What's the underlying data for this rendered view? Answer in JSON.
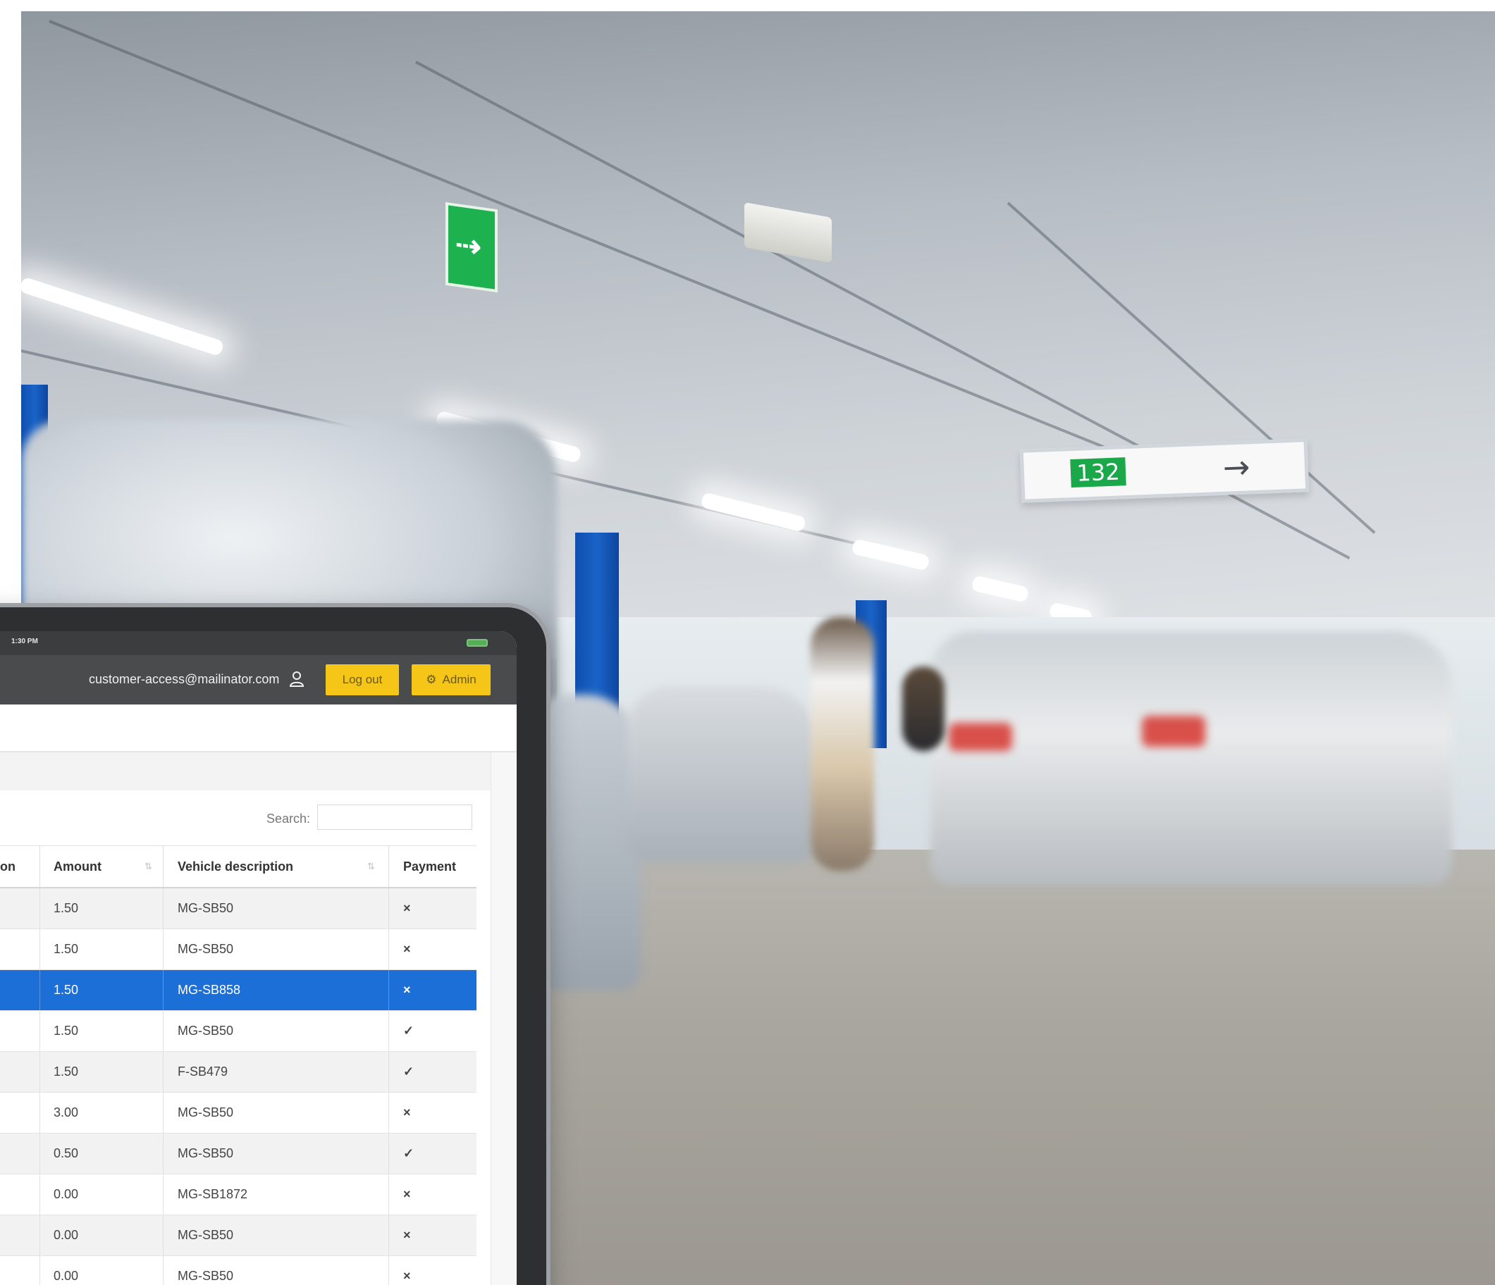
{
  "photo": {
    "guide_sign_number": "132",
    "guide_sign_arrow": "→",
    "exit_sign_glyph": "⇢"
  },
  "statusbar": {
    "time": "1:30 PM"
  },
  "topbar": {
    "user_email": "customer-access@mailinator.com",
    "logout_label": "Log out",
    "admin_label": "Admin",
    "user_icon": "user-icon",
    "admin_icon": "gear-icon"
  },
  "table": {
    "search_label": "Search:",
    "search_value": "",
    "columns": [
      {
        "label": "on"
      },
      {
        "label": "Amount"
      },
      {
        "label": "Vehicle description"
      },
      {
        "label": "Payment"
      }
    ],
    "rows": [
      {
        "amount": "1.50",
        "vehicle": "MG-SB50",
        "payment": "×",
        "paid": false
      },
      {
        "amount": "1.50",
        "vehicle": "MG-SB50",
        "payment": "×",
        "paid": false
      },
      {
        "amount": "1.50",
        "vehicle": "MG-SB858",
        "payment": "×",
        "paid": false,
        "selected": true
      },
      {
        "amount": "1.50",
        "vehicle": "MG-SB50",
        "payment": "✓",
        "paid": true
      },
      {
        "amount": "1.50",
        "vehicle": "F-SB479",
        "payment": "✓",
        "paid": true
      },
      {
        "amount": "3.00",
        "vehicle": "MG-SB50",
        "payment": "×",
        "paid": false
      },
      {
        "amount": "0.50",
        "vehicle": "MG-SB50",
        "payment": "✓",
        "paid": true
      },
      {
        "amount": "0.00",
        "vehicle": "MG-SB1872",
        "payment": "×",
        "paid": false
      },
      {
        "amount": "0.00",
        "vehicle": "MG-SB50",
        "payment": "×",
        "paid": false
      },
      {
        "amount": "0.00",
        "vehicle": "MG-SB50",
        "payment": "×",
        "paid": false
      }
    ]
  },
  "colors": {
    "accent_yellow": "#f5c518",
    "selected_row": "#1d6fd8",
    "topbar": "#4a4b4d",
    "pillar_blue": "#1a63c7",
    "sign_green": "#1aa84a"
  }
}
